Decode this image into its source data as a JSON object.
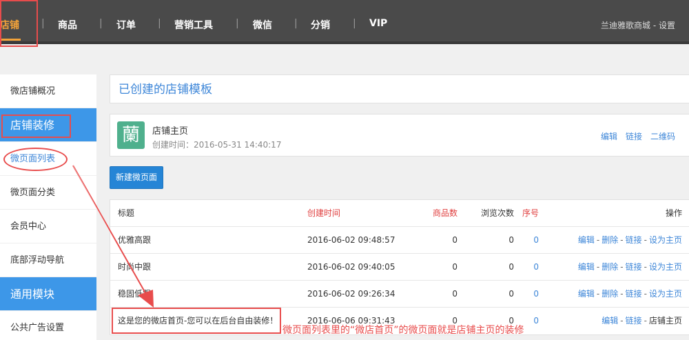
{
  "nav": {
    "items": [
      "店铺",
      "商品",
      "订单",
      "营销工具",
      "微信",
      "分销",
      "VIP"
    ],
    "active_index": 0,
    "separator": "|",
    "right_text": "兰迪雅歌商城 - 设置"
  },
  "sidebar": {
    "items": [
      {
        "label": "微店铺概况",
        "style": "normal"
      },
      {
        "label": "店铺装修",
        "style": "section"
      },
      {
        "label": "微页面列表",
        "style": "sub"
      },
      {
        "label": "微页面分类",
        "style": "normal"
      },
      {
        "label": "会员中心",
        "style": "normal"
      },
      {
        "label": "底部浮动导航",
        "style": "normal"
      },
      {
        "label": "通用模块",
        "style": "section"
      },
      {
        "label": "公共广告设置",
        "style": "normal"
      }
    ]
  },
  "main": {
    "title": "已创建的店铺模板",
    "template": {
      "logo_char": "蘭",
      "name": "店铺主页",
      "created": "创建时间：2016-05-31 14:40:17",
      "actions": [
        "编辑",
        "链接",
        "二维码"
      ]
    },
    "new_button": "新建微页面",
    "table": {
      "headers": {
        "title": "标题",
        "time": "创建时间",
        "goods": "商品数",
        "views": "浏览次数",
        "order": "序号",
        "ops": "操作"
      },
      "rows": [
        {
          "title": "优雅高跟",
          "time": "2016-06-02 09:48:57",
          "goods": "0",
          "views": "0",
          "order": "0",
          "ops": [
            "编辑",
            "删除",
            "链接",
            "设为主页"
          ]
        },
        {
          "title": "时尚中跟",
          "time": "2016-06-02 09:40:05",
          "goods": "0",
          "views": "0",
          "order": "0",
          "ops": [
            "编辑",
            "删除",
            "链接",
            "设为主页"
          ]
        },
        {
          "title": "稳固低跟",
          "time": "2016-06-02 09:26:34",
          "goods": "0",
          "views": "0",
          "order": "0",
          "ops": [
            "编辑",
            "删除",
            "链接",
            "设为主页"
          ]
        },
        {
          "title": "这是您的微店首页-您可以在后台自由装修！",
          "time": "2016-06-06 09:31:43",
          "goods": "0",
          "views": "0",
          "order": "0",
          "ops": [
            "编辑",
            "链接"
          ],
          "status": "店铺主页"
        }
      ]
    }
  },
  "annotation": "微页面列表里的“微店首页”的微页面就是店铺主页的装修",
  "colors": {
    "accent_orange": "#f3a33a",
    "sidebar_blue": "#3d97e8",
    "link_blue": "#3d86d8",
    "annotation_red": "#e84c4c",
    "header_red": "#e04040"
  }
}
